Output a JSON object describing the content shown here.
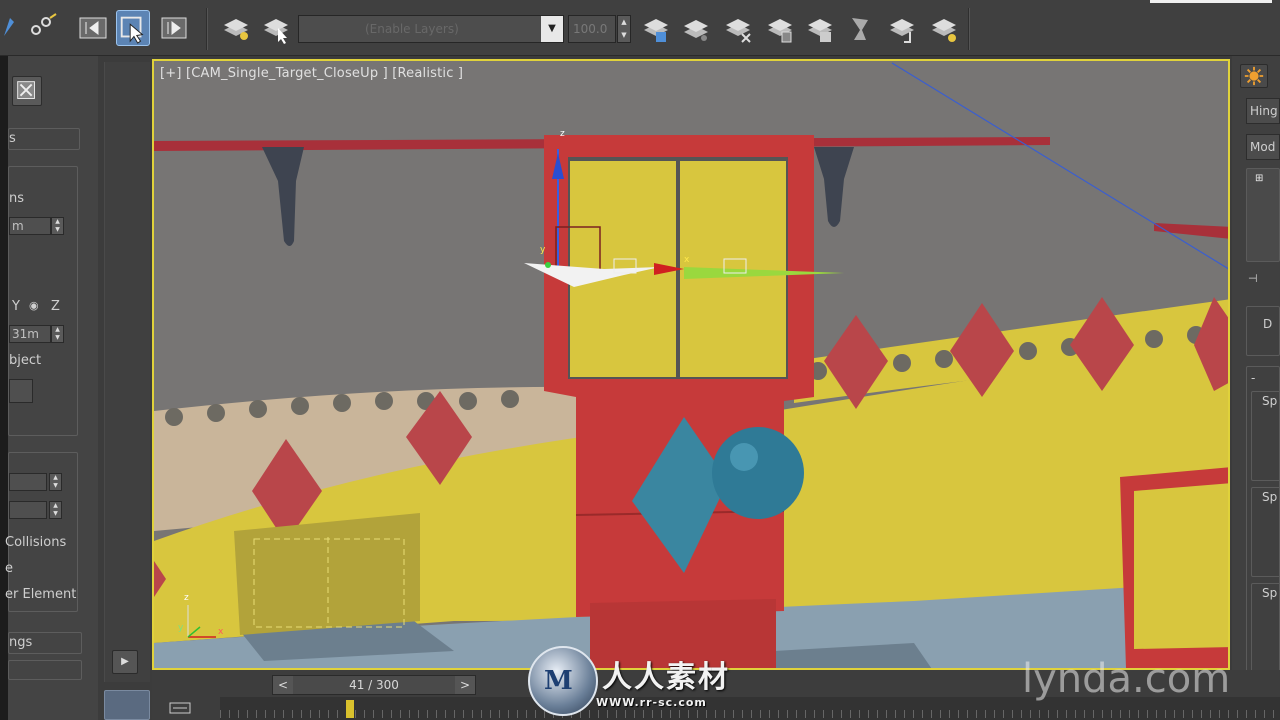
{
  "toolbar": {
    "layer_dropdown_placeholder": "(Enable Layers)",
    "zoom_value": "100.0",
    "buttons": [
      "select-and-link",
      "unlink-selection",
      "bind-to-space-warp",
      "select-object",
      "select-by-name",
      "layer-manager",
      "create-new-layer",
      "add-selection-to-layer",
      "select-objects-in-layer",
      "delete-layer",
      "set-current-layer",
      "hide-layer",
      "freeze-layer",
      "isolate-layer",
      "move-layer",
      "layer-properties"
    ]
  },
  "left_panel": {
    "rollout_label_1": "s",
    "params_label": "ns",
    "unit_field": "m",
    "axis_labels": [
      "Y",
      "Z"
    ],
    "value_field": "31m",
    "object_label": "bject",
    "collisions_label": "Collisions",
    "e_label": "e",
    "element_label": "er Element",
    "ngs_label": "ngs"
  },
  "viewport": {
    "label": "[+] [CAM_Single_Target_CloseUp ] [Realistic ]",
    "gizmo_labels": {
      "z": "z",
      "y": "y",
      "x": "x"
    },
    "axis_tripod": {
      "z": "z",
      "y": "y",
      "x": "x"
    },
    "colors": {
      "wall": "#757575",
      "ceiling_beam": "#a8303a",
      "frame_red": "#c63a3a",
      "panel_yellow": "#d8c63e",
      "ground_blue": "#8aa0b0",
      "diamond_teal": "#3a86a0",
      "sphere_teal": "#2f7a96",
      "selection_border": "#e0d23b"
    }
  },
  "right_panel": {
    "hinge_button": "Hing",
    "modifier_button": "Mod",
    "dash_label": "-",
    "sp_labels": [
      "Sp",
      "Sp",
      "Sp"
    ],
    "d_label": "D"
  },
  "timeline": {
    "frame_indicator": "41 / 300",
    "prev_arrow": "<",
    "next_arrow": ">"
  },
  "watermark": {
    "site_title": "人人素材",
    "site_url": "WWW.rr-sc.com",
    "logo_letters": "M",
    "lynda": "lynda.com"
  }
}
